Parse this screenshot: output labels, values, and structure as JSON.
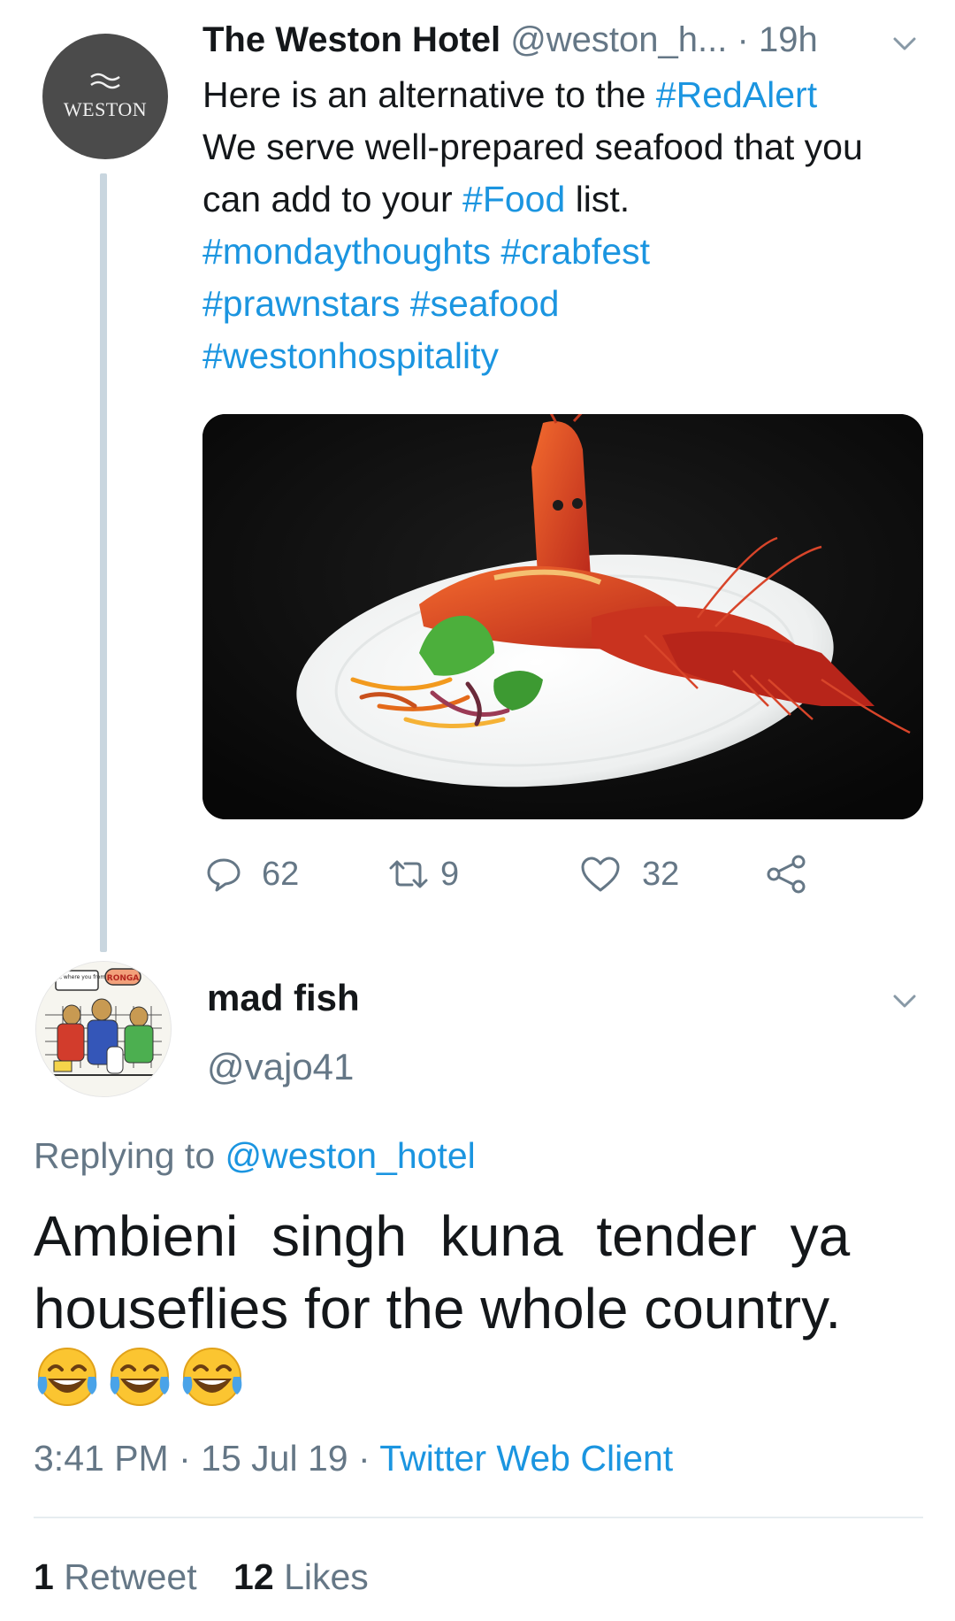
{
  "tweet": {
    "author_name": "The Weston Hotel",
    "handle": "@weston_h...",
    "separator": "·",
    "time": "19h",
    "avatar_text": "WESTON",
    "lines": [
      [
        {
          "t": "Here is an alternative to the ",
          "tag": false
        },
        {
          "t": "#RedAlert",
          "tag": true
        }
      ],
      [
        {
          "t": "We serve well-prepared seafood that you",
          "tag": false
        }
      ],
      [
        {
          "t": "can add to your ",
          "tag": false
        },
        {
          "t": "#Food",
          "tag": true
        },
        {
          "t": " list.",
          "tag": false
        }
      ],
      [
        {
          "t": "#mondaythoughts",
          "tag": true
        },
        {
          "t": " ",
          "tag": false
        },
        {
          "t": "#crabfest",
          "tag": true
        }
      ],
      [
        {
          "t": "#prawnstars",
          "tag": true
        },
        {
          "t": " ",
          "tag": false
        },
        {
          "t": "#seafood",
          "tag": true
        }
      ],
      [
        {
          "t": "#westonhospitality",
          "tag": true
        }
      ]
    ],
    "reply_count": "62",
    "retweet_count": "9",
    "like_count": "32"
  },
  "reply": {
    "avatar_text_1": "Mehn, where you from?",
    "avatar_text_2": "RONGA",
    "author_name": "mad fish",
    "handle": "@vajo41",
    "replying_prefix": "Replying to ",
    "replying_to": "@weston_hotel",
    "text_line1": "Ambieni singh kuna tender ya",
    "text_line2": "houseflies for the whole country.",
    "emoji_count": 3,
    "time": "3:41 PM",
    "date": "15 Jul 19",
    "dot": "·",
    "client": "Twitter Web Client",
    "retweets_num": "1",
    "retweets_label": "Retweet",
    "likes_num": "12",
    "likes_label": "Likes"
  },
  "colors": {
    "link": "#1b95e0",
    "muted": "#657786",
    "text": "#14171a",
    "thread_line": "#c9d6df"
  },
  "icons": [
    "chevron-down-icon",
    "reply-icon",
    "retweet-icon",
    "like-icon",
    "share-icon",
    "tears-of-joy-emoji"
  ]
}
